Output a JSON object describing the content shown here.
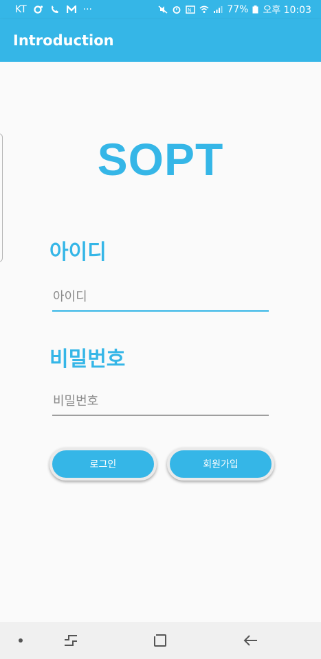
{
  "status_bar": {
    "carrier": "KT",
    "more_indicator": "···",
    "battery": "77%",
    "time": "오후 10:03"
  },
  "app_bar": {
    "title": "Introduction"
  },
  "logo": {
    "text": "SOPT"
  },
  "id_field": {
    "label": "아이디",
    "placeholder": "아이디",
    "value": ""
  },
  "password_field": {
    "label": "비밀번호",
    "placeholder": "비밀번호",
    "value": ""
  },
  "buttons": {
    "login": "로그인",
    "signup": "회원가입"
  },
  "colors": {
    "accent": "#35b6e7",
    "focused_underline": "#35b6e7",
    "underline": "#9e9e9e"
  },
  "icons": [
    "record-icon",
    "call-icon",
    "mail-icon",
    "mute-icon",
    "alarm-icon",
    "nfc-icon",
    "wifi-icon",
    "signal-icon",
    "battery-icon",
    "recent-apps-icon",
    "home-icon",
    "back-icon"
  ]
}
